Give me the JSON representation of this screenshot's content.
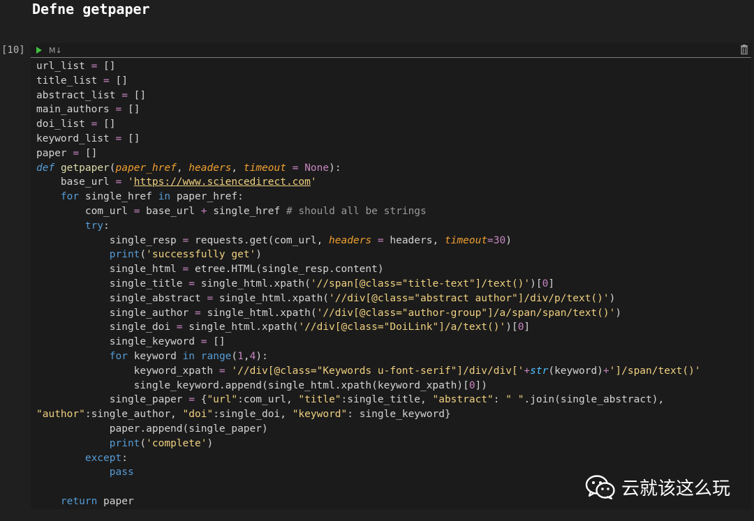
{
  "heading": "Defne getpaper",
  "cell": {
    "exec_count": "[10]",
    "md_toggle": "M↓"
  },
  "code_lines": [
    "url_list = []",
    "title_list = []",
    "abstract_list = []",
    "main_authors = []",
    "doi_list = []",
    "keyword_list = []",
    "paper = []",
    "def getpaper(paper_href, headers, timeout = None):",
    "    base_url = 'https://www.sciencedirect.com'",
    "    for single_href in paper_href:",
    "        com_url = base_url + single_href # should all be strings",
    "        try:",
    "            single_resp = requests.get(com_url, headers = headers, timeout=30)",
    "            print('successfully get')",
    "            single_html = etree.HTML(single_resp.content)",
    "            single_title = single_html.xpath('//span[@class=\"title-text\"]/text()')[0]",
    "            single_abstract = single_html.xpath('//div[@class=\"abstract author\"]/div/p/text()')",
    "            single_author = single_html.xpath('//div[@class=\"author-group\"]/a/span/span/text()')",
    "            single_doi = single_html.xpath('//div[@class=\"DoiLink\"]/a/text()')[0]",
    "            single_keyword = []",
    "            for keyword in range(1,4):",
    "                keyword_xpath = '//div[@class=\"Keywords u-font-serif\"]/div/div['+str(keyword)+']/span/text()'",
    "                single_keyword.append(single_html.xpath(keyword_xpath)[0])",
    "            single_paper = {\"url\":com_url, \"title\":single_title, \"abstract\": \" \".join(single_abstract),",
    "\"author\":single_author, \"doi\":single_doi, \"keyword\": single_keyword}",
    "            paper.append(single_paper)",
    "            print('complete')",
    "        except:",
    "            pass",
    "",
    "    return paper"
  ],
  "watermark": {
    "text": "云就该这么玩",
    "icon": "wechat-icon"
  },
  "colors": {
    "background": "#1f1f1f",
    "keyword": "#569cd6",
    "string": "#f0d080",
    "parameter": "#f0a030",
    "run": "#3fbf3f"
  }
}
